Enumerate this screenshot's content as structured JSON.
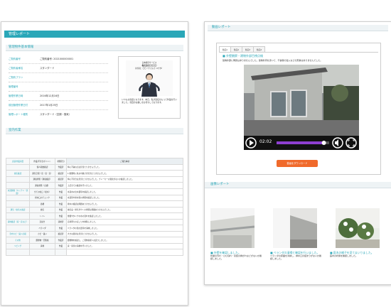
{
  "left": {
    "title": "管理レポート",
    "basic_info": {
      "heading": "管理物件基本情報",
      "rows": [
        {
          "label": "ご契約番号",
          "value": "ご契約番号: 2021000000001"
        },
        {
          "label": "ご契約者様名",
          "value": "スタンダード"
        },
        {
          "label": "ご契約プラン",
          "value": ""
        },
        {
          "label": "管理番号",
          "value": ""
        },
        {
          "label": "管理作業日時",
          "value": "2016年12月16日"
        },
        {
          "label": "前回管理作業日付",
          "value": "2017年1月25日"
        },
        {
          "label": "管理レポート種別",
          "value": "スタンダード（空調・換気）"
        }
      ],
      "owner_card": {
        "company": "日本総合サービス",
        "name_label": "株式会社〇〇〇〇",
        "manager": "担当者：〇〇（ナカムラ ユウタ）",
        "message": "いつもお世話になります。本日、私が責任をもって作業を行いました。次回のお越しをお待ちしております。"
      }
    },
    "check": {
      "heading": "室内作業",
      "headers": [
        "点検/作業項目",
        "作業/不具合ポイント",
        "状態区分",
        "ご報告事項"
      ],
      "rows": [
        {
          "cat": "",
          "item": "個人開放確認",
          "status": "作業済",
          "note": "特に不審な点は見当たりませんでした。"
        },
        {
          "cat": "換気確認",
          "item": "通気空間（窓・扉・窓）",
          "status": "確認済",
          "note": "1.開閉時に軋みや錆びが見当たりませんでした。"
        },
        {
          "cat": "",
          "item": "通電状態（通電確認）",
          "status": "確認済",
          "note": "特に不具合は見当たりませんでした。ブレーカーの異常がないか確認しました。"
        },
        {
          "cat": "",
          "item": "通電状態（点検）",
          "status": "作業済",
          "note": "上記全ての確認を行いました。"
        },
        {
          "cat": "水道関係（キッチン・洗面）",
          "item": "全ての蛇口（給水）",
          "status": "作業",
          "note": "水道水の出水量等を確認しました。"
        },
        {
          "cat": "",
          "item": "排水口のチェック",
          "status": "作業",
          "note": "水道管や排水管の状態を確認しました。"
        },
        {
          "cat": "",
          "item": "浴槽",
          "status": "作業",
          "note": "排水の確認は問題ありませんでした。"
        },
        {
          "cat": "通気・換気の確認",
          "item": "換気",
          "status": "作業",
          "note": "換気扇・排気ダクトの状態は問題ありませんでした。"
        },
        {
          "cat": "",
          "item": "トイレ",
          "status": "作業",
          "note": "便器やタンクの水の流れを確認しました。"
        },
        {
          "cat": "清掃確認（床・窓など）",
          "item": "窓拭き",
          "status": "清掃済",
          "note": "窓枠周りのほこりを掃除しました。"
        },
        {
          "cat": "",
          "item": "ベランダ",
          "status": "作業",
          "note": "ベランダの落ち葉等を清掃しました。"
        },
        {
          "cat": "室内カビ・臭い点検",
          "item": "カビ・臭い",
          "status": "確認済",
          "note": "大きな異常は見当たりませんでした。"
        },
        {
          "cat": "その他",
          "item": "郵便物・回覧板",
          "status": "作業済",
          "note": "郵便物を確認し、ご契約者様へお送りしました。"
        },
        {
          "cat": "リビング",
          "item": "清掃",
          "status": "作業",
          "note": "床・家具の清掃を行いました。"
        },
        {
          "cat": "",
          "item": "",
          "status": "",
          "note": ""
        }
      ]
    }
  },
  "right": {
    "video": {
      "heading": "動画レポート",
      "tabs": [
        "動画1",
        "動画2",
        "動画3",
        "動画4"
      ],
      "title": "外壁観察・建物外部目視点検",
      "note": "建物外部に問題はありませんでした。建物外周を歩いて、不審者の侵入などの形跡はありませんでした。",
      "time": "02:02",
      "progress": 0.9,
      "download_label": "動画をダウンロード"
    },
    "photos": {
      "heading": "画像レポート",
      "items": [
        {
          "title": "外壁を確認しました。",
          "text": "外壁の汚れ・ひび割れ・塗装の剥がれなどがないか確認しました。"
        },
        {
          "title": "ベランダの清掃と確認を行いました。",
          "text": "ベランダの床面を清掃し、排水口の詰まりがないか確認しました。"
        },
        {
          "title": "庭木の様子を見てまいりました。",
          "text": "庭木の状態を確認しました。"
        }
      ]
    }
  }
}
